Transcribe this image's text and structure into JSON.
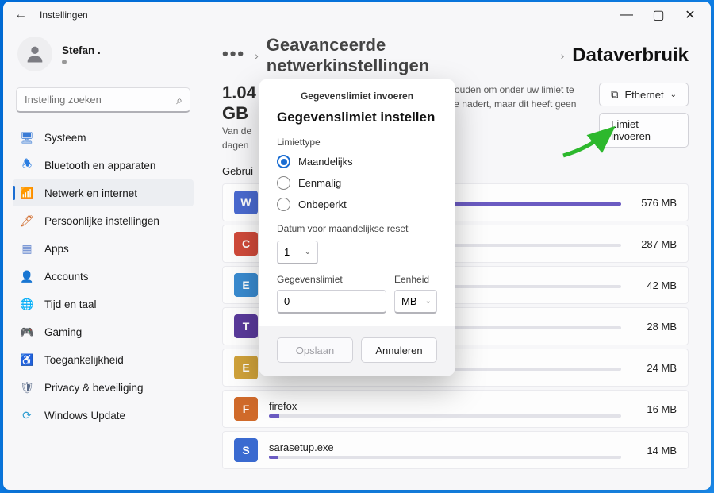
{
  "window": {
    "title": "Instellingen"
  },
  "user": {
    "name": "Stefan ."
  },
  "search": {
    "placeholder": "Instelling zoeken"
  },
  "nav": [
    {
      "label": "Systeem",
      "icon": "system",
      "color": "#3a7bd5"
    },
    {
      "label": "Bluetooth en apparaten",
      "icon": "bluetooth",
      "color": "#2a7de1"
    },
    {
      "label": "Netwerk en internet",
      "icon": "wifi",
      "color": "#1aa7d0",
      "active": true
    },
    {
      "label": "Persoonlijke instellingen",
      "icon": "brush",
      "color": "#d06a2a"
    },
    {
      "label": "Apps",
      "icon": "apps",
      "color": "#6a8bd0"
    },
    {
      "label": "Accounts",
      "icon": "account",
      "color": "#7a9bb8"
    },
    {
      "label": "Tijd en taal",
      "icon": "time",
      "color": "#d0a228"
    },
    {
      "label": "Gaming",
      "icon": "gaming",
      "color": "#3aa84a"
    },
    {
      "label": "Toegankelijkheid",
      "icon": "access",
      "color": "#3a6ad0"
    },
    {
      "label": "Privacy & beveiliging",
      "icon": "privacy",
      "color": "#5a6b88"
    },
    {
      "label": "Windows Update",
      "icon": "update",
      "color": "#2a9bd0"
    }
  ],
  "breadcrumb": {
    "level1": "Geavanceerde netwerkinstellingen",
    "level2": "Dataverbruik"
  },
  "summary": {
    "total": "1.04 GB",
    "desc_prefix": "Van de",
    "desc_line2": "dagen",
    "right_text": "te houden om onder uw limiet te deze nadert, maar dit heeft geen",
    "ethernet_btn": "Ethernet",
    "limit_btn": "Limiet invoeren"
  },
  "usage_header": "Gebrui",
  "apps": [
    {
      "name": "",
      "size": "576 MB",
      "pct": 100,
      "color": "#4a6ad0",
      "letter": "W"
    },
    {
      "name": "",
      "size": "287 MB",
      "pct": 50,
      "color": "#d04a3a",
      "letter": "C"
    },
    {
      "name": "",
      "size": "42 MB",
      "pct": 8,
      "color": "#3a8bd0",
      "letter": "E"
    },
    {
      "name": "",
      "size": "28 MB",
      "pct": 5,
      "color": "#5a3a9b",
      "letter": "T"
    },
    {
      "name": "",
      "size": "24 MB",
      "pct": 4,
      "color": "#d0a23a",
      "letter": "E"
    },
    {
      "name": "firefox",
      "size": "16 MB",
      "pct": 3,
      "color": "#d06a2a",
      "letter": "F"
    },
    {
      "name": "sarasetup.exe",
      "size": "14 MB",
      "pct": 2.5,
      "color": "#3a6ad0",
      "letter": "S"
    }
  ],
  "dialog": {
    "pretitle": "Gegevenslimiet invoeren",
    "title": "Gegevenslimiet instellen",
    "limit_type_label": "Limiettype",
    "options": [
      "Maandelijks",
      "Eenmalig",
      "Onbeperkt"
    ],
    "selected": 0,
    "reset_label": "Datum voor maandelijkse reset",
    "reset_value": "1",
    "data_limit_label": "Gegevenslimiet",
    "unit_label": "Eenheid",
    "data_limit_value": "0",
    "unit_value": "MB",
    "save": "Opslaan",
    "cancel": "Annuleren"
  }
}
